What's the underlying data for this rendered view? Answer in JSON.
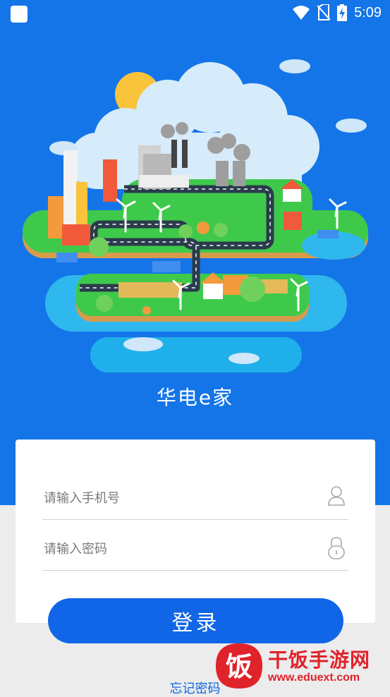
{
  "status_bar": {
    "time": "5:09",
    "icons": [
      "app-square-icon",
      "wifi-icon",
      "no-sim-icon",
      "battery-charging-icon"
    ]
  },
  "app": {
    "title": "华电e家"
  },
  "login_form": {
    "phone_placeholder": "请输入手机号",
    "password_placeholder": "请输入密码",
    "phone_icon": "user-icon",
    "password_icon": "lock-icon",
    "submit_label": "登录",
    "forgot_label": "忘记密码"
  },
  "watermark": {
    "logo_char": "饭",
    "name": "干饭手游网",
    "url": "www.eduext.com"
  },
  "colors": {
    "brand_blue": "#1475e8",
    "button_blue": "#1066e6",
    "watermark_red": "#e0222a"
  }
}
